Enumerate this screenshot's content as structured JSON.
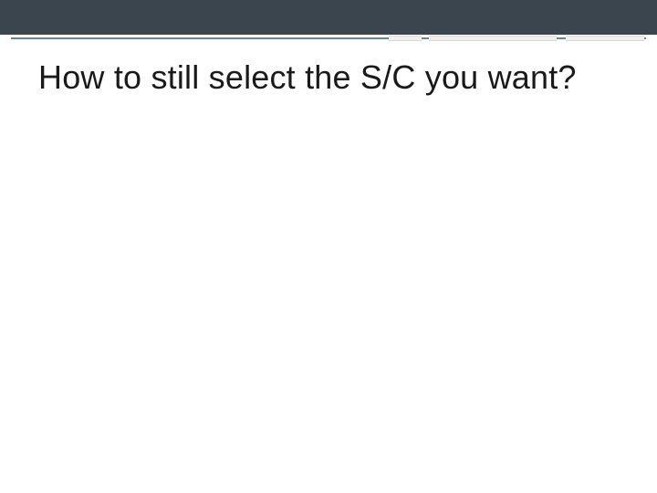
{
  "slide": {
    "title": "How to still select the S/C you want?"
  },
  "colors": {
    "topbar": "#3a454e",
    "accent": "#5f8b8f",
    "segment": "#f1f0ef"
  }
}
